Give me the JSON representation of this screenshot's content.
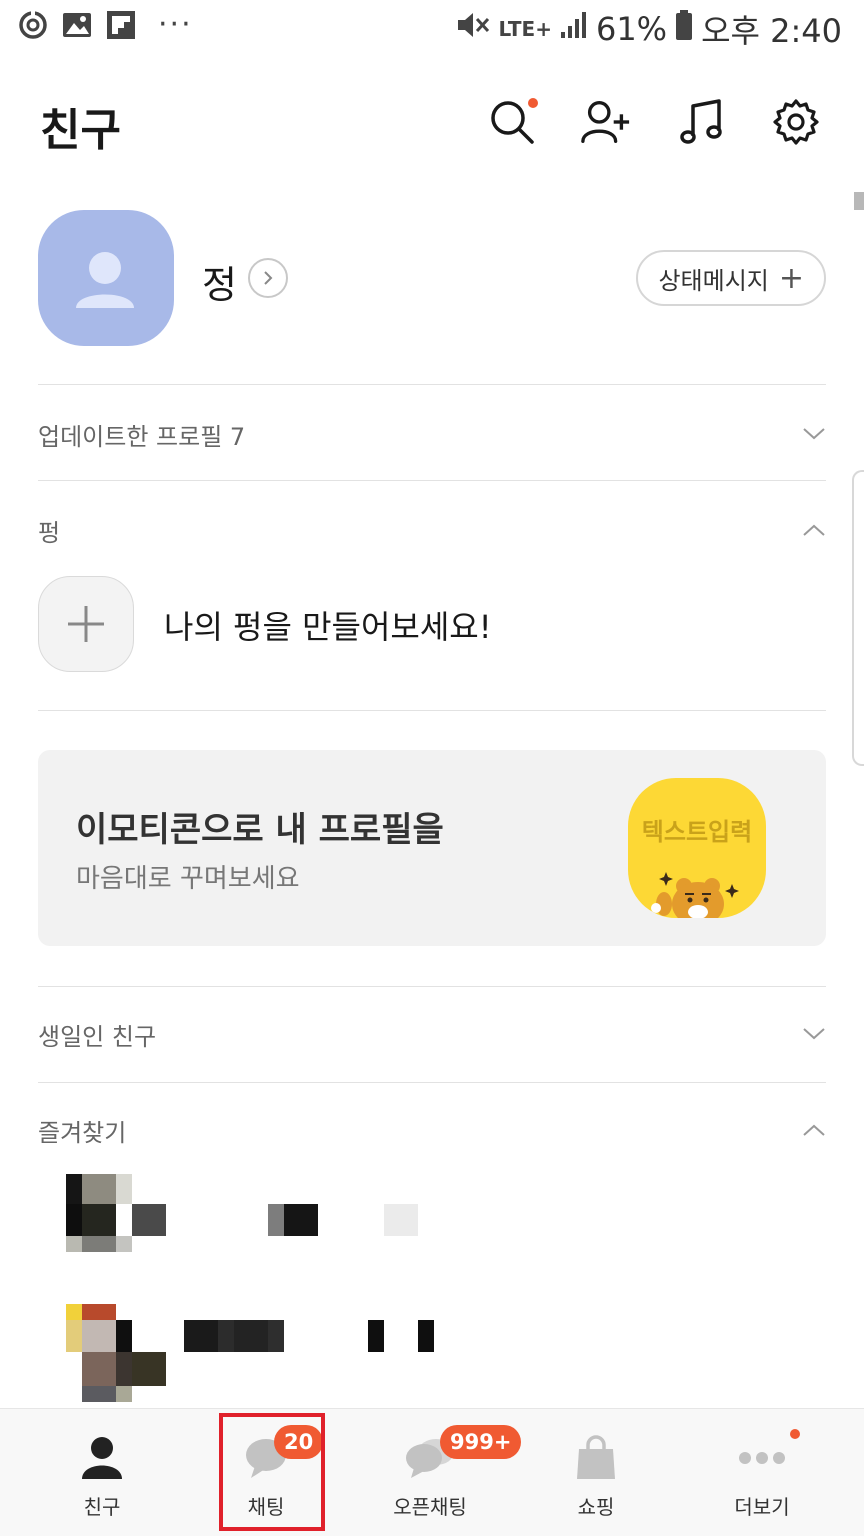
{
  "status_bar": {
    "network": "LTE+",
    "battery": "61%",
    "time": "오후 2:40",
    "more": "···"
  },
  "header": {
    "title": "친구",
    "icons": [
      "search-icon",
      "add-friend-icon",
      "music-icon",
      "settings-icon"
    ]
  },
  "profile": {
    "name": "정",
    "status_button": "상태메시지",
    "status_plus": "+"
  },
  "sections": {
    "updated_profiles": "업데이트한 프로필 7",
    "pung": "펑",
    "pung_prompt": "나의 펑을 만들어보세요!",
    "birthday": "생일인 친구",
    "favorites": "즐겨찾기"
  },
  "banner": {
    "title": "이모티콘으로 내 프로필을",
    "subtitle": "마음대로 꾸며보세요",
    "emoticon_text": "텍스트입력"
  },
  "bottom_nav": {
    "items": [
      {
        "label": "친구",
        "icon": "person-icon",
        "badge": ""
      },
      {
        "label": "채팅",
        "icon": "chat-bubble-icon",
        "badge": "20"
      },
      {
        "label": "오픈채팅",
        "icon": "open-chat-icon",
        "badge": "999+"
      },
      {
        "label": "쇼핑",
        "icon": "shopping-bag-icon",
        "badge": ""
      },
      {
        "label": "더보기",
        "icon": "more-icon",
        "badge": ""
      }
    ]
  },
  "colors": {
    "accent_red": "#f05a32",
    "avatar_blue": "#a8b9e8",
    "highlight": "#e0212b",
    "emoticon_yellow": "#fdd835"
  }
}
